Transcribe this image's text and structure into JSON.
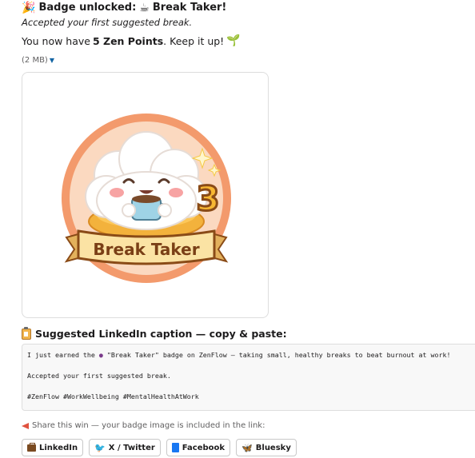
{
  "header": {
    "title_prefix": "Badge unlocked:",
    "title_name": "Break Taker!",
    "subtitle": "Accepted your first suggested break.",
    "points_before": "You now have",
    "points_value": "5 Zen Points",
    "points_after": ". Keep it up!",
    "icons": [
      "party-popper-icon",
      "coffee-icon",
      "sprout-icon"
    ]
  },
  "attachment": {
    "size_label": "(2 MB)",
    "badge_banner_text": "Break Taker",
    "badge_number": "3"
  },
  "caption": {
    "heading": "Suggested LinkedIn caption — copy & paste:",
    "line1_before": "I just earned the",
    "line1_after": "\"Break Taker\" badge on ZenFlow — taking small, healthy breaks to beat burnout at work!",
    "line2": "Accepted your first suggested break.",
    "line3": "#ZenFlow #WorkWellbeing #MentalHealthAtWork"
  },
  "share": {
    "prompt": "Share this win — your badge image is included in the link:",
    "buttons": [
      {
        "label": "LinkedIn",
        "icon": "briefcase-icon"
      },
      {
        "label": "X / Twitter",
        "icon": "bird-icon"
      },
      {
        "label": "Facebook",
        "icon": "facebook-icon"
      },
      {
        "label": "Bluesky",
        "icon": "butterfly-icon"
      }
    ]
  },
  "colors": {
    "link_blue": "#1264a3",
    "badge_orange": "#f08a5d",
    "banner_cream": "#fbe3a4",
    "text": "#1d1c1d",
    "muted": "#616061"
  }
}
